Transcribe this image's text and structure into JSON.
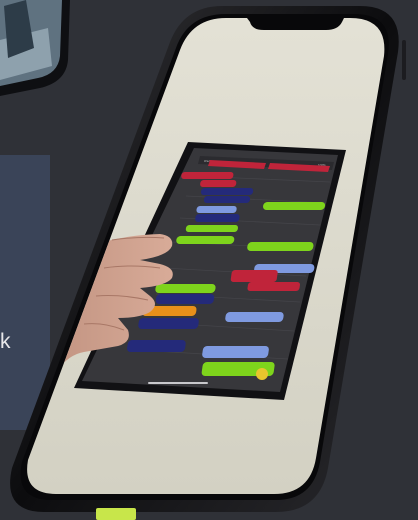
{
  "side_fragment": {
    "text": "k"
  },
  "tablet": {
    "status_left": "iPad",
    "status_right": "100%",
    "column_headers": [
      "",
      ""
    ]
  },
  "colors": {
    "background": "#2f3137",
    "side_panel": "#3a4458",
    "phone_frame": "#0b0b0d",
    "phone_screen": "#dcdccc",
    "tablet_bezel": "#111114",
    "tablet_screen": "#37373b",
    "block_red": "#c0243a",
    "block_navy": "#242a7a",
    "block_green": "#7ed41c",
    "block_orange": "#e8901a",
    "block_lightblue": "#7f9ae0",
    "block_yellow": "#e9c62d",
    "accent_yellow_green": "#c8e64a"
  },
  "blocks": [
    {
      "color": "red",
      "label": ""
    },
    {
      "color": "red",
      "label": ""
    },
    {
      "color": "navy",
      "label": ""
    },
    {
      "color": "navy",
      "label": ""
    },
    {
      "color": "green",
      "label": ""
    },
    {
      "color": "lightblue",
      "label": ""
    },
    {
      "color": "navy",
      "label": ""
    },
    {
      "color": "green",
      "label": ""
    },
    {
      "color": "green",
      "label": ""
    },
    {
      "color": "red",
      "label": ""
    },
    {
      "color": "lightblue",
      "label": ""
    },
    {
      "color": "red",
      "label": ""
    },
    {
      "color": "green",
      "label": ""
    },
    {
      "color": "navy",
      "label": ""
    },
    {
      "color": "orange",
      "label": ""
    },
    {
      "color": "lightblue",
      "label": ""
    },
    {
      "color": "navy",
      "label": ""
    },
    {
      "color": "lightblue",
      "label": ""
    },
    {
      "color": "navy",
      "label": ""
    },
    {
      "color": "green",
      "label": ""
    }
  ]
}
